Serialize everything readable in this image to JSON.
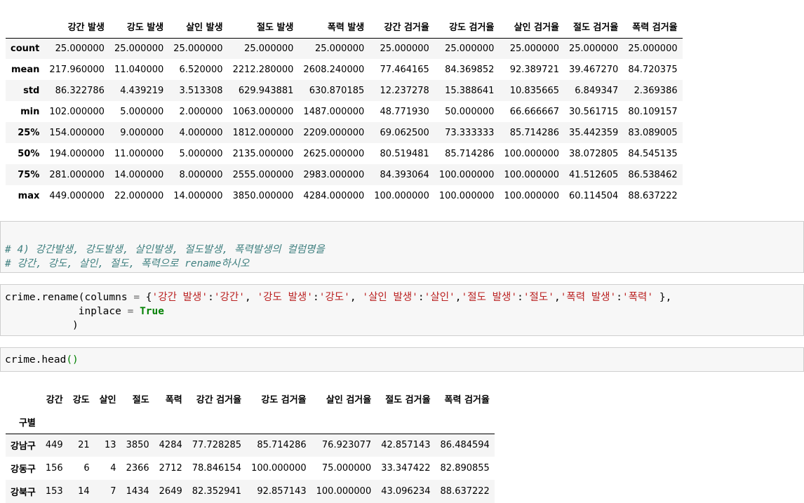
{
  "describe": {
    "columns": [
      "강간 발생",
      "강도 발생",
      "살인 발생",
      "절도 발생",
      "폭력 발생",
      "강간 검거율",
      "강도 검거율",
      "살인 검거율",
      "절도 검거율",
      "폭력 검거율"
    ],
    "rows": [
      {
        "label": "count",
        "values": [
          "25.000000",
          "25.000000",
          "25.000000",
          "25.000000",
          "25.000000",
          "25.000000",
          "25.000000",
          "25.000000",
          "25.000000",
          "25.000000"
        ]
      },
      {
        "label": "mean",
        "values": [
          "217.960000",
          "11.040000",
          "6.520000",
          "2212.280000",
          "2608.240000",
          "77.464165",
          "84.369852",
          "92.389721",
          "39.467270",
          "84.720375"
        ]
      },
      {
        "label": "std",
        "values": [
          "86.322786",
          "4.439219",
          "3.513308",
          "629.943881",
          "630.870185",
          "12.237278",
          "15.388641",
          "10.835665",
          "6.849347",
          "2.369386"
        ]
      },
      {
        "label": "min",
        "values": [
          "102.000000",
          "5.000000",
          "2.000000",
          "1063.000000",
          "1487.000000",
          "48.771930",
          "50.000000",
          "66.666667",
          "30.561715",
          "80.109157"
        ]
      },
      {
        "label": "25%",
        "values": [
          "154.000000",
          "9.000000",
          "4.000000",
          "1812.000000",
          "2209.000000",
          "69.062500",
          "73.333333",
          "85.714286",
          "35.442359",
          "83.089005"
        ]
      },
      {
        "label": "50%",
        "values": [
          "194.000000",
          "11.000000",
          "5.000000",
          "2135.000000",
          "2625.000000",
          "80.519481",
          "85.714286",
          "100.000000",
          "38.072805",
          "84.545135"
        ]
      },
      {
        "label": "75%",
        "values": [
          "281.000000",
          "14.000000",
          "8.000000",
          "2555.000000",
          "2983.000000",
          "84.393064",
          "100.000000",
          "100.000000",
          "41.512605",
          "86.538462"
        ]
      },
      {
        "label": "max",
        "values": [
          "449.000000",
          "22.000000",
          "14.000000",
          "3850.000000",
          "4284.000000",
          "100.000000",
          "100.000000",
          "100.000000",
          "60.114504",
          "88.637222"
        ]
      }
    ]
  },
  "comment_cell": {
    "line1": "# 4) 강간발생, 강도발생, 살인발생, 절도발생, 폭력발생의 컬럼명을",
    "line2": "# 강간, 강도, 살인, 절도, 폭력으로 rename하시오"
  },
  "rename_cell": {
    "t1": "crime.rename(columns ",
    "t2": "=",
    "t3": " {",
    "s1": "'강간 발생'",
    "c1": ":",
    "s2": "'강간'",
    "t4": ", ",
    "s3": "'강도 발생'",
    "c2": ":",
    "s4": "'강도'",
    "t5": ", ",
    "s5": "'살인 발생'",
    "c3": ":",
    "s6": "'살인'",
    "t6": ",",
    "s7": "'절도 발생'",
    "c4": ":",
    "s8": "'절도'",
    "t7": ",",
    "s9": "'폭력 발생'",
    "c5": ":",
    "s10": "'폭력'",
    "t8": " },",
    "l2a": "            inplace ",
    "l2b": "=",
    "l2c": " ",
    "l2kw": "True",
    "l3": "           )"
  },
  "head_cell": {
    "code": "crime.head",
    "parens": "()"
  },
  "head_table": {
    "columns": [
      "강간",
      "강도",
      "살인",
      "절도",
      "폭력",
      "강간 검거율",
      "강도 검거율",
      "살인 검거율",
      "절도 검거율",
      "폭력 검거율"
    ],
    "index_name": "구별",
    "rows": [
      {
        "label": "강남구",
        "values": [
          "449",
          "21",
          "13",
          "3850",
          "4284",
          "77.728285",
          "85.714286",
          "76.923077",
          "42.857143",
          "86.484594"
        ]
      },
      {
        "label": "강동구",
        "values": [
          "156",
          "6",
          "4",
          "2366",
          "2712",
          "78.846154",
          "100.000000",
          "75.000000",
          "33.347422",
          "82.890855"
        ]
      },
      {
        "label": "강북구",
        "values": [
          "153",
          "14",
          "7",
          "1434",
          "2649",
          "82.352941",
          "92.857143",
          "100.000000",
          "43.096234",
          "88.637222"
        ]
      }
    ]
  }
}
